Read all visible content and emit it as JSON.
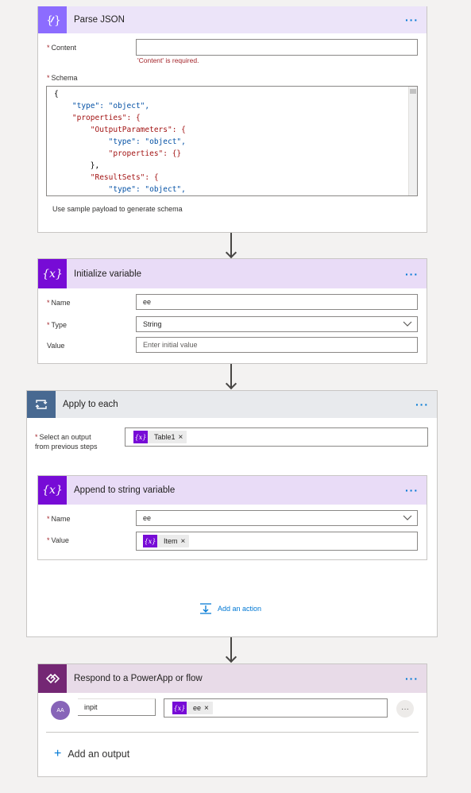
{
  "parse_json": {
    "title": "Parse JSON",
    "content_label": "Content",
    "content_error": "'Content' is required.",
    "schema_label": "Schema",
    "schema_lines": [
      "{",
      "    \"type\": \"object\",",
      "    \"properties\": {",
      "        \"OutputParameters\": {",
      "            \"type\": \"object\",",
      "            \"properties\": {}",
      "        },",
      "        \"ResultSets\": {",
      "            \"type\": \"object\","
    ],
    "sample_link": "Use sample payload to generate schema"
  },
  "init_var": {
    "title": "Initialize variable",
    "name_label": "Name",
    "name_value": "ee",
    "type_label": "Type",
    "type_value": "String",
    "value_label": "Value",
    "value_placeholder": "Enter initial value"
  },
  "apply_each": {
    "title": "Apply to each",
    "select_label_1": "Select an output",
    "select_label_2": "from previous steps",
    "token_label": "Table1",
    "add_action": "Add an action"
  },
  "append_var": {
    "title": "Append to string variable",
    "name_label": "Name",
    "name_value": "ee",
    "value_label": "Value",
    "token_label": "Item"
  },
  "respond": {
    "title": "Respond to a PowerApp or flow",
    "avatar_text": "AA",
    "output_name": "inpit",
    "token_label": "ee",
    "add_output": "Add an output"
  },
  "common": {
    "more": "···",
    "remove": "×",
    "var_icon": "{x}",
    "token_icon": "{x}"
  },
  "colors": {
    "variable_purple": "#770bd6",
    "variable_header_bg": "#e9dcf7",
    "loop_gray": "#486991",
    "powerapps_purple": "#742774",
    "link_blue": "#0078d4",
    "error_red": "#a4262c"
  }
}
